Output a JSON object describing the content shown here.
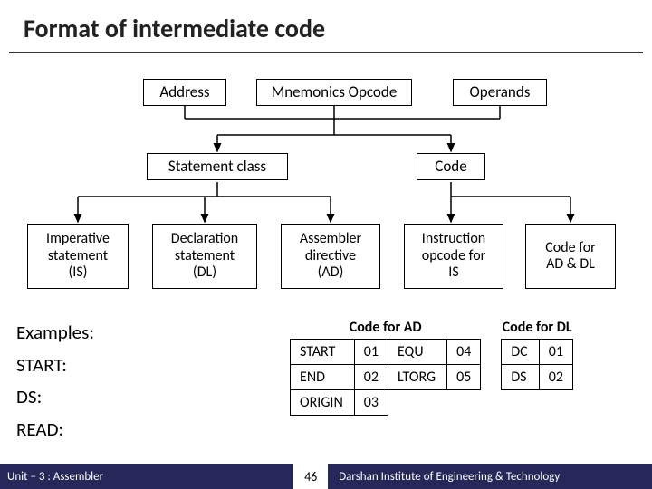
{
  "title": "Format of intermediate code",
  "level1": {
    "address": "Address",
    "mnemonics": "Mnemonics Opcode",
    "operands": "Operands"
  },
  "level2": {
    "statement_class": "Statement class",
    "code": "Code"
  },
  "level3": {
    "is": "Imperative\nstatement\n(IS)",
    "dl": "Declaration\nstatement\n(DL)",
    "ad": "Assembler\ndirective\n(AD)",
    "iop": "Instruction\nopcode for\nIS",
    "caddl": "Code for\nAD & DL"
  },
  "examples": {
    "heading": "Examples:",
    "items": [
      "START:",
      "DS:",
      "READ:"
    ]
  },
  "table_ad": {
    "title": "Code for AD",
    "rows": [
      [
        "START",
        "01",
        "EQU",
        "04"
      ],
      [
        "END",
        "02",
        "LTORG",
        "05"
      ],
      [
        "ORIGIN",
        "03",
        "",
        ""
      ]
    ]
  },
  "table_dl": {
    "title": "Code for DL",
    "rows": [
      [
        "DC",
        "01"
      ],
      [
        "DS",
        "02"
      ]
    ]
  },
  "footer": {
    "unit": "Unit – 3 : Assembler",
    "page": "46",
    "institute": "Darshan Institute of Engineering & Technology"
  }
}
